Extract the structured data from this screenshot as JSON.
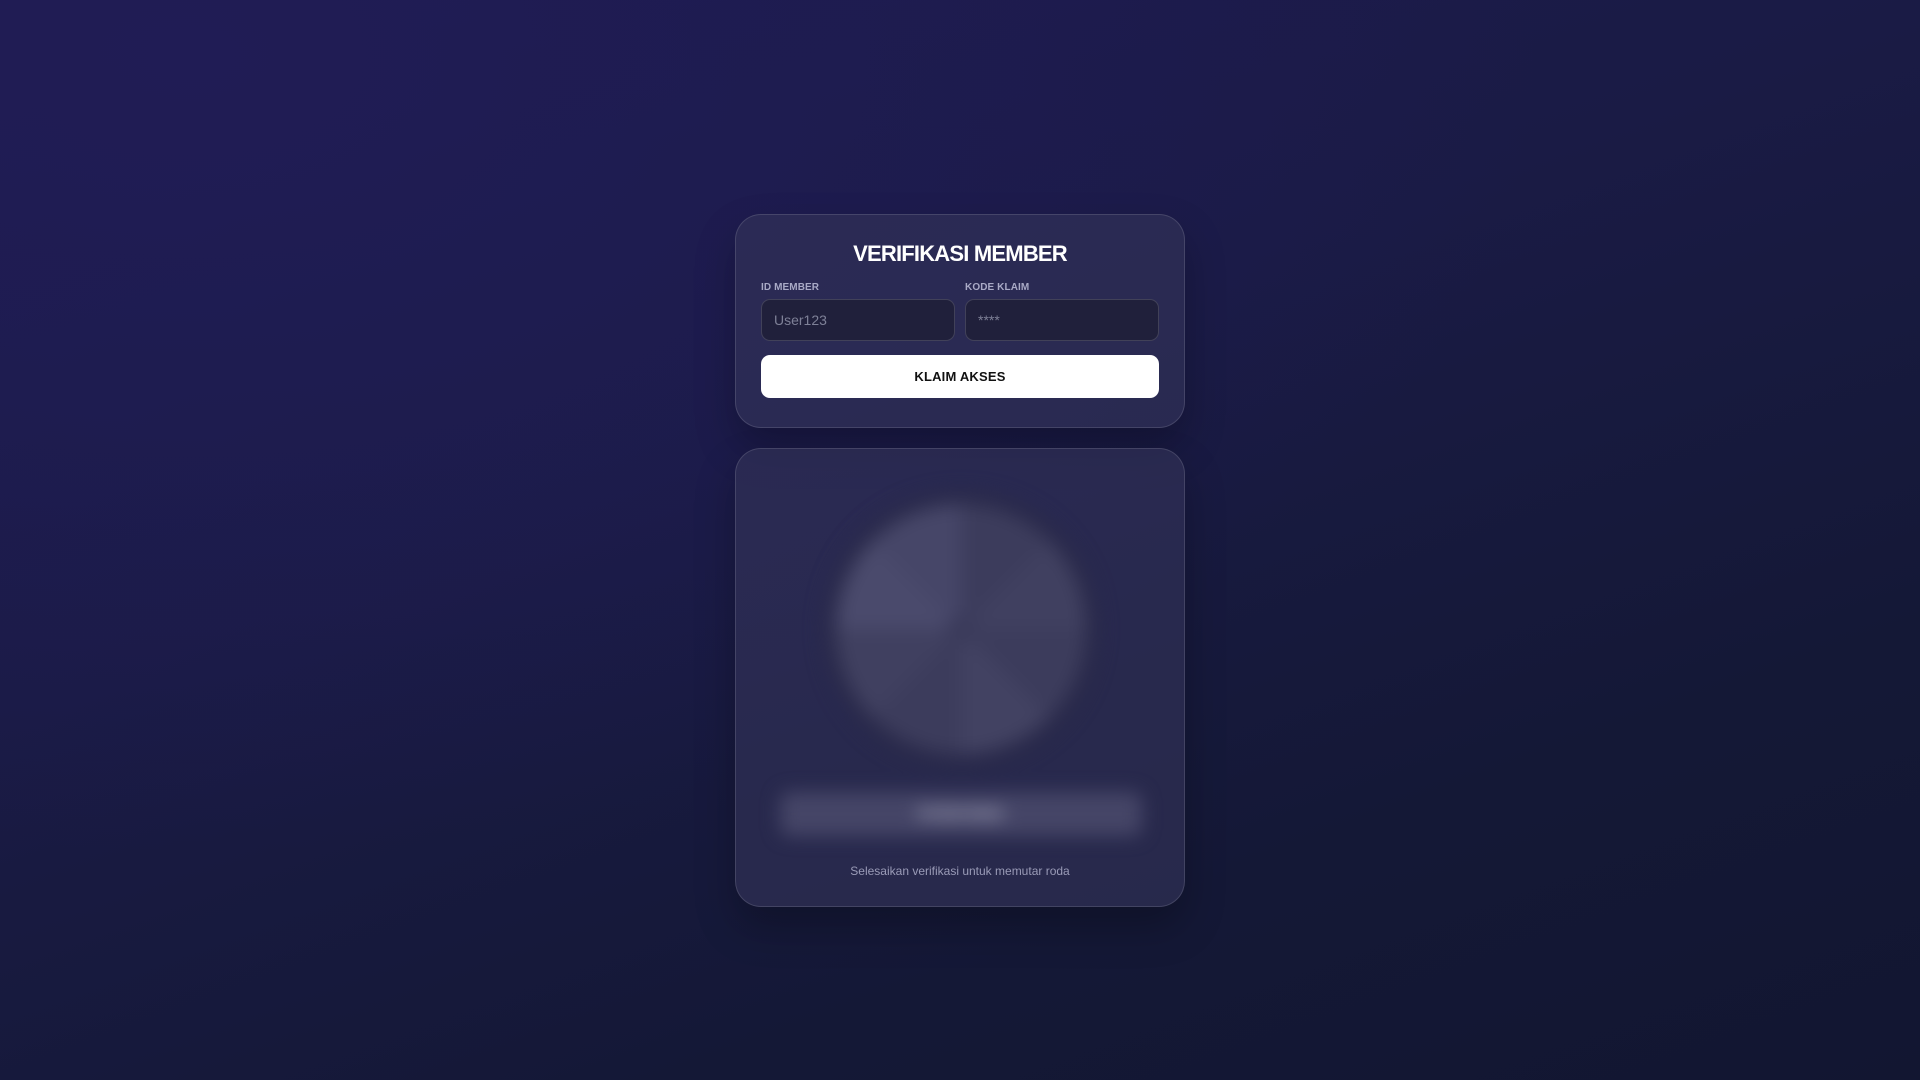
{
  "login": {
    "title": "VERIFIKASI MEMBER",
    "member_id": {
      "label": "ID MEMBER",
      "placeholder": "User123",
      "value": ""
    },
    "claim_code": {
      "label": "KODE KLAIM",
      "placeholder": "****",
      "value": ""
    },
    "submit_label": "KLAIM AKSES"
  },
  "wheel": {
    "locked": true,
    "blurred_button_label": "PUTAR RODA",
    "hint": "Selesaikan verifikasi untuk memutar roda"
  },
  "colors": {
    "background": "#1a1a48",
    "card": "#2e2e52",
    "button": "#ffffff"
  }
}
